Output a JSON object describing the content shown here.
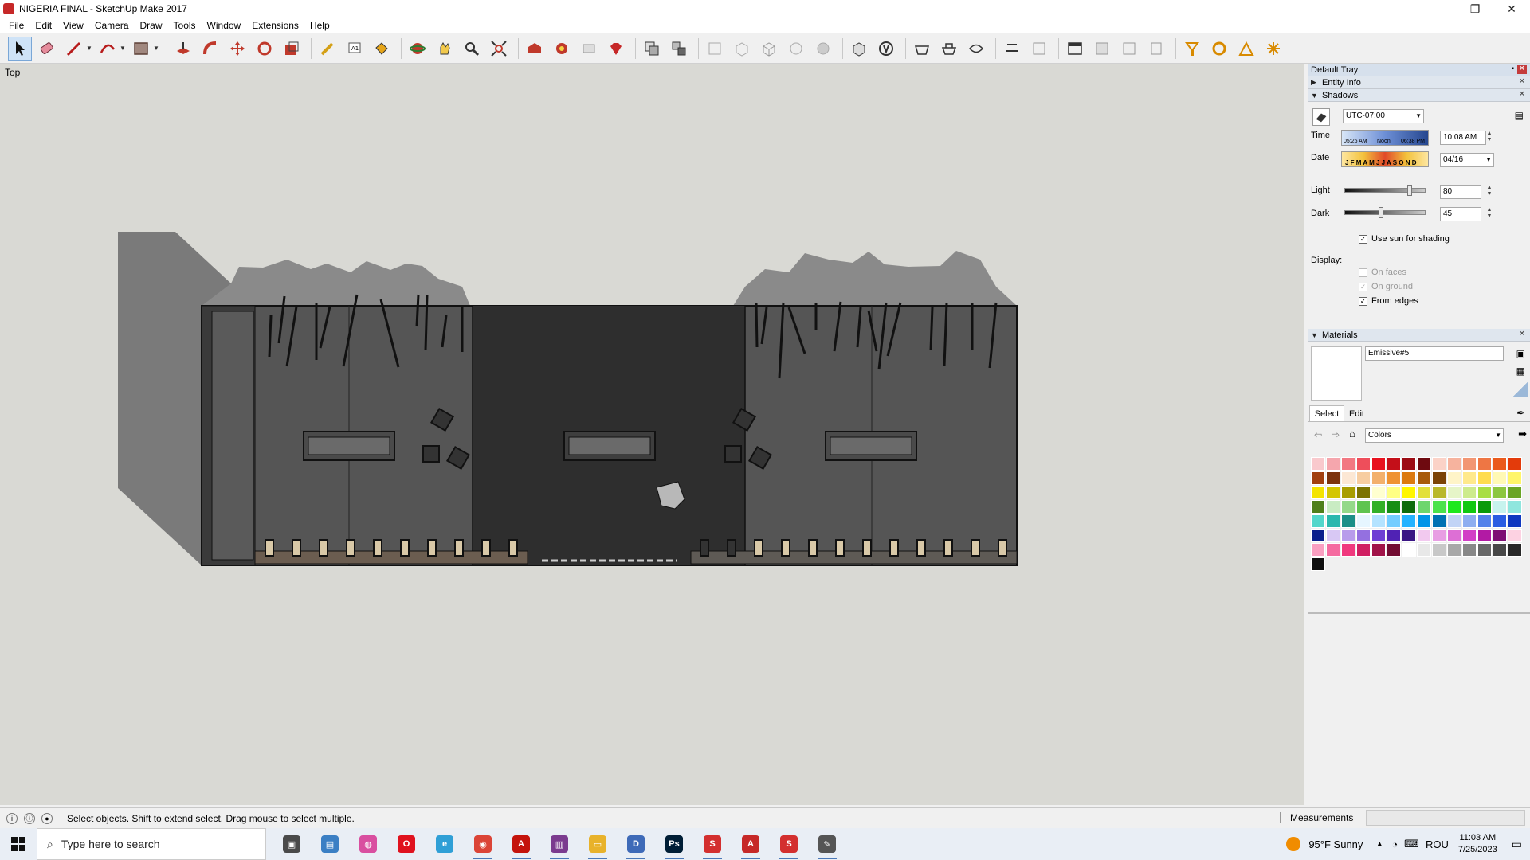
{
  "window": {
    "title": "NIGERIA FINAL - SketchUp Make 2017",
    "controls": [
      "–",
      "❐",
      "✕"
    ]
  },
  "menu": [
    "File",
    "Edit",
    "View",
    "Camera",
    "Draw",
    "Tools",
    "Window",
    "Extensions",
    "Help"
  ],
  "toolbar": {
    "tools": [
      "select-icon",
      "eraser-icon",
      "line-icon",
      "arc-icon",
      "rectangle-icon",
      "push-pull-icon",
      "follow-me-icon",
      "move-icon",
      "rotate-icon",
      "scale-icon",
      "tape-measure-icon",
      "text-icon",
      "paint-bucket-icon",
      "orbit-icon",
      "pan-icon",
      "zoom-icon",
      "zoom-extents-icon",
      "warehouse-icon",
      "extension-warehouse-icon",
      "share-model-icon",
      "ruby-icon",
      "components-icon",
      "groups-icon",
      "xray-icon",
      "back-edges-icon",
      "wireframe-icon",
      "hidden-line-icon",
      "shaded-icon",
      "textured-icon",
      "monochrome-icon",
      "iso-view-icon",
      "top-view-icon",
      "front-view-icon",
      "right-view-icon",
      "back-view-icon",
      "left-view-icon",
      "perspective-icon",
      "section-plane-icon",
      "display-section-icon",
      "section-cuts-icon",
      "position-camera-icon",
      "look-around-icon",
      "walk-icon",
      "sandbox-icon"
    ]
  },
  "viewport": {
    "scene_label": "Top"
  },
  "tray": {
    "title": "Default Tray",
    "entity_info": "Entity Info",
    "shadows": {
      "heading": "Shadows",
      "timezone": "UTC-07:00",
      "time_label": "Time",
      "time_ticks": [
        "05:26 AM",
        "Noon",
        "06:38 PM"
      ],
      "time_value": "10:08 AM",
      "date_label": "Date",
      "date_months": "J F M A M J J A S O N D",
      "date_value": "04/16",
      "light_label": "Light",
      "light_value": "80",
      "light_level": 0.8,
      "dark_label": "Dark",
      "dark_value": "45",
      "dark_level": 0.45,
      "use_sun": "Use sun for shading",
      "display_label": "Display:",
      "on_faces": "On faces",
      "on_ground": "On ground",
      "from_edges": "From edges"
    },
    "materials": {
      "heading": "Materials",
      "name": "Emissive#5",
      "tab_select": "Select",
      "tab_edit": "Edit",
      "library": "Colors",
      "swatches": [
        "#f9c9cd",
        "#f5a6ad",
        "#f27882",
        "#ee4e5b",
        "#e8121f",
        "#c40f19",
        "#9c0c14",
        "#6e0a10",
        "#fbd2c7",
        "#f6b39e",
        "#f29673",
        "#ee7644",
        "#ea5a1c",
        "#e33b0b",
        "#a2400f",
        "#7c330d",
        "#fce7d4",
        "#f7cda1",
        "#f3b06c",
        "#ef9232",
        "#dc7a10",
        "#a85b0a",
        "#7b4307",
        "#fff4c8",
        "#ffe98c",
        "#ffdc4e",
        "#fff9b5",
        "#fff56a",
        "#f4e400",
        "#d4c600",
        "#a89d00",
        "#7c7300",
        "#ffffd0",
        "#ffff84",
        "#fff600",
        "#e2e03a",
        "#b9b82b",
        "#e6f5c8",
        "#cdeb8c",
        "#a9de43",
        "#8cc63f",
        "#6aa525",
        "#4f7f1b",
        "#c9ecc3",
        "#95d98a",
        "#5fc450",
        "#34b027",
        "#168e14",
        "#0e6b0c",
        "#6dd66d",
        "#4be24b",
        "#1ee81e",
        "#10c810",
        "#0a9a0a",
        "#c7f3ee",
        "#8fe6de",
        "#52d6cb",
        "#2bb8ae",
        "#1b8f88",
        "#e6f6ff",
        "#b4e3ff",
        "#74cdff",
        "#25b2ff",
        "#0094e8",
        "#0072b4",
        "#c2d4f6",
        "#8eaef0",
        "#5482ea",
        "#2a5ce2",
        "#0f38c0",
        "#0a1e8c",
        "#d8c8f4",
        "#b89ceb",
        "#9470e0",
        "#6e3fd4",
        "#5022b4",
        "#3a1684",
        "#f2c9ef",
        "#e89ee3",
        "#dd6fd5",
        "#d23fc6",
        "#b21aa4",
        "#7e0f75",
        "#fdd2e2",
        "#fa9fc1",
        "#f56ba0",
        "#f0397e",
        "#d01f62",
        "#a11449",
        "#720c32",
        "#ffffff",
        "#e8e8e8",
        "#c8c8c8",
        "#a8a8a8",
        "#888888",
        "#686868",
        "#484848",
        "#282828",
        "#101010"
      ]
    }
  },
  "status": {
    "hint": "Select objects. Shift to extend select. Drag mouse to select multiple.",
    "measurements_label": "Measurements"
  },
  "taskbar": {
    "search_placeholder": "Type here to search",
    "apps": [
      {
        "name": "task-view-icon",
        "color": "#4a4a4a",
        "glyph": "▣"
      },
      {
        "name": "control-panel-icon",
        "color": "#3b7fc4",
        "glyph": "▤"
      },
      {
        "name": "color-app-icon",
        "color": "#d94fa0",
        "glyph": "◍"
      },
      {
        "name": "opera-icon",
        "color": "#e0121e",
        "glyph": "O"
      },
      {
        "name": "edge-icon",
        "color": "#2f9fd6",
        "glyph": "e"
      },
      {
        "name": "chrome-icon",
        "color": "#db4437",
        "glyph": "◉"
      },
      {
        "name": "acrobat-icon",
        "color": "#c4130c",
        "glyph": "A"
      },
      {
        "name": "winrar-icon",
        "color": "#7b3b8f",
        "glyph": "▥"
      },
      {
        "name": "explorer-icon",
        "color": "#e8b22b",
        "glyph": "▭"
      },
      {
        "name": "dwg-icon",
        "color": "#3e6ab8",
        "glyph": "D"
      },
      {
        "name": "photoshop-icon",
        "color": "#001e36",
        "glyph": "Ps"
      },
      {
        "name": "sketchup-icon",
        "color": "#d32f2f",
        "glyph": "S"
      },
      {
        "name": "autocad-icon",
        "color": "#c62828",
        "glyph": "A"
      },
      {
        "name": "sketchup-active-icon",
        "color": "#d32f2f",
        "glyph": "S"
      },
      {
        "name": "style-builder-icon",
        "color": "#555555",
        "glyph": "✎"
      }
    ],
    "weather": "95°F  Sunny",
    "language": "ROU",
    "time": "11:03 AM",
    "date": "7/25/2023"
  }
}
